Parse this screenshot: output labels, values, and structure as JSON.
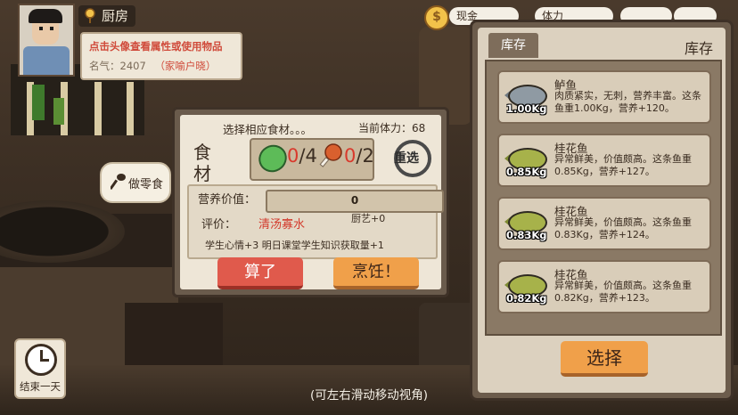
{
  "location": {
    "name": "厨房"
  },
  "profile": {
    "hint": "点击头像查看属性或使用物品",
    "fame_label": "名气：",
    "fame_value": "2407",
    "fame_title": "（家喻户晓）"
  },
  "topbar": {
    "cash_label": "现金",
    "stamina_label": "体力"
  },
  "snack_button": {
    "label": "做零食"
  },
  "cooking": {
    "title": "选择相应食材。。。",
    "stamina_text": "当前体力：68",
    "ingredients_label": "食材",
    "vegetable": {
      "current": "0",
      "required": "/4"
    },
    "meat": {
      "current": "0",
      "required": "/2"
    },
    "reselect_label": "重选",
    "nutrition_label": "营养价值：",
    "nutrition_value": "0",
    "nutrition_fraction": 0,
    "rating_label": "评价：",
    "rating_value": "清汤寡水",
    "skill_text": "厨艺+0",
    "effects_text": "学生心情+3  明日课堂学生知识获取量+1",
    "cancel_label": "算了",
    "cook_label": "烹饪！"
  },
  "inventory": {
    "tab_label": "库存",
    "title": "库存",
    "items": [
      {
        "name": "鲈鱼",
        "weight": "1.00Kg",
        "desc": "肉质紧实，无刺，营养丰富。这条鱼重1.00Kg，营养+120。",
        "fish": "perch"
      },
      {
        "name": "桂花鱼",
        "weight": "0.85Kg",
        "desc": "异常鲜美，价值颇高。这条鱼重0.85Kg，营养+127。",
        "fish": "mandarin"
      },
      {
        "name": "桂花鱼",
        "weight": "0.83Kg",
        "desc": "异常鲜美，价值颇高。这条鱼重0.83Kg，营养+124。",
        "fish": "mandarin"
      },
      {
        "name": "桂花鱼",
        "weight": "0.82Kg",
        "desc": "异常鲜美，价值颇高。这条鱼重0.82Kg，营养+123。",
        "fish": "mandarin"
      }
    ],
    "select_label": "选择"
  },
  "end_day": {
    "label": "结束一天"
  },
  "bottom_hint": "(可左右滑动移动视角)",
  "colors": {
    "accent_orange": "#f0a04a",
    "cancel_red": "#e05a4c",
    "panel_brown": "#6c5c4c",
    "warn_red": "#d33a2c"
  }
}
